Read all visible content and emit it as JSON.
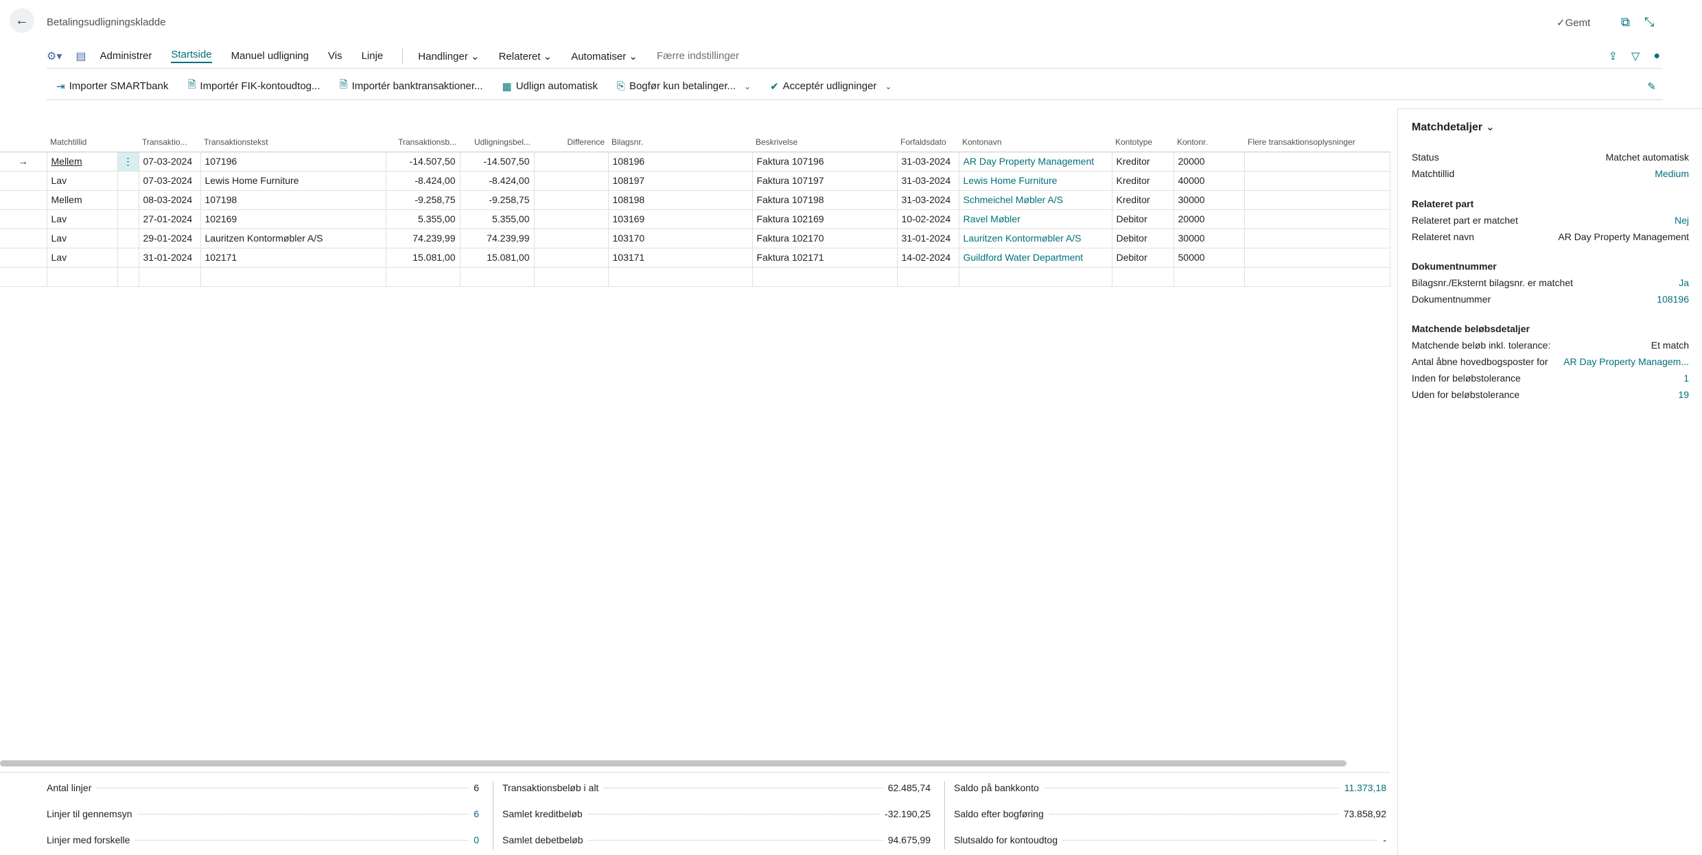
{
  "header": {
    "title": "Betalingsudligningskladde",
    "saved": "Gemt",
    "back_icon": "arrow-left-icon"
  },
  "menu": {
    "items": [
      "Administrer",
      "Startside",
      "Manuel udligning",
      "Vis",
      "Linje"
    ],
    "dropdowns": [
      "Handlinger",
      "Relateret",
      "Automatiser"
    ],
    "fewer": "Færre indstillinger"
  },
  "actions": {
    "import_smartbank": "Importer SMARTbank",
    "import_fik": "Importér FIK-kontoudtog...",
    "import_bank": "Importér banktransaktioner...",
    "auto_apply": "Udlign automatisk",
    "post_payments": "Bogfør kun betalinger...",
    "accept": "Acceptér udligninger"
  },
  "grid": {
    "columns": [
      "Matchtillid",
      "Transaktio...",
      "Transaktionstekst",
      "Transaktionsb...",
      "Udligningsbel...",
      "Difference",
      "Bilagsnr.",
      "Beskrivelse",
      "Forfaldsdato",
      "Kontonavn",
      "Kontotype",
      "Kontonr.",
      "Flere transaktionsoplysninger"
    ],
    "rows": [
      {
        "conf": "Mellem",
        "date": "07-03-2024",
        "text": "107196",
        "amount": "-14.507,50",
        "applied": "-14.507,50",
        "diff": "",
        "doc": "108196",
        "desc": "Faktura 107196",
        "due": "31-03-2024",
        "account": "AR Day Property Management",
        "type": "Kreditor",
        "no": "20000",
        "more": ""
      },
      {
        "conf": "Lav",
        "date": "07-03-2024",
        "text": "Lewis Home Furniture",
        "amount": "-8.424,00",
        "applied": "-8.424,00",
        "diff": "",
        "doc": "108197",
        "desc": "Faktura 107197",
        "due": "31-03-2024",
        "account": "Lewis Home Furniture",
        "type": "Kreditor",
        "no": "40000",
        "more": ""
      },
      {
        "conf": "Mellem",
        "date": "08-03-2024",
        "text": "107198",
        "amount": "-9.258,75",
        "applied": "-9.258,75",
        "diff": "",
        "doc": "108198",
        "desc": "Faktura 107198",
        "due": "31-03-2024",
        "account": "Schmeichel Møbler A/S",
        "type": "Kreditor",
        "no": "30000",
        "more": ""
      },
      {
        "conf": "Lav",
        "date": "27-01-2024",
        "text": "102169",
        "amount": "5.355,00",
        "applied": "5.355,00",
        "diff": "",
        "doc": "103169",
        "desc": "Faktura 102169",
        "due": "10-02-2024",
        "account": "Ravel Møbler",
        "type": "Debitor",
        "no": "20000",
        "more": ""
      },
      {
        "conf": "Lav",
        "date": "29-01-2024",
        "text": "Lauritzen Kontormøbler A/S",
        "amount": "74.239,99",
        "applied": "74.239,99",
        "diff": "",
        "doc": "103170",
        "desc": "Faktura 102170",
        "due": "31-01-2024",
        "account": "Lauritzen Kontormøbler A/S",
        "type": "Debitor",
        "no": "30000",
        "more": ""
      },
      {
        "conf": "Lav",
        "date": "31-01-2024",
        "text": "102171",
        "amount": "15.081,00",
        "applied": "15.081,00",
        "diff": "",
        "doc": "103171",
        "desc": "Faktura 102171",
        "due": "14-02-2024",
        "account": "Guildford Water Department",
        "type": "Debitor",
        "no": "50000",
        "more": ""
      }
    ]
  },
  "footer": {
    "col1": [
      {
        "label": "Antal linjer",
        "value": "6"
      },
      {
        "label": "Linjer til gennemsyn",
        "value": "6"
      },
      {
        "label": "Linjer med forskelle",
        "value": "0"
      }
    ],
    "col2": [
      {
        "label": "Transaktionsbeløb i alt",
        "value": "62.485,74"
      },
      {
        "label": "Samlet kreditbeløb",
        "value": "-32.190,25"
      },
      {
        "label": "Samlet debetbeløb",
        "value": "94.675,99"
      }
    ],
    "col3": [
      {
        "label": "Saldo på bankkonto",
        "value": "11.373,18"
      },
      {
        "label": "Saldo efter bogføring",
        "value": "73.858,92"
      },
      {
        "label": "Slutsaldo for kontoudtog",
        "value": "-"
      }
    ]
  },
  "factbox": {
    "title": "Matchdetaljer",
    "status_label": "Status",
    "status_value": "Matchet automatisk",
    "conf_label": "Matchtillid",
    "conf_value": "Medium",
    "sec_related": "Relateret part",
    "rel_matched_label": "Relateret part er matchet",
    "rel_matched_value": "Nej",
    "rel_name_label": "Relateret navn",
    "rel_name_value": "AR Day Property Management",
    "sec_doc": "Dokumentnummer",
    "doc_matched_label": "Bilagsnr./Eksternt bilagsnr. er matchet",
    "doc_matched_value": "Ja",
    "doc_no_label": "Dokumentnummer",
    "doc_no_value": "108196",
    "sec_amount": "Matchende beløbsdetaljer",
    "tol_label": "Matchende beløb inkl. tolerance:",
    "tol_value": "Et match",
    "open_label": "Antal åbne hovedbogsposter for",
    "open_value": "AR Day Property Managem...",
    "within_label": "Inden for beløbstolerance",
    "within_value": "1",
    "outside_label": "Uden for beløbstolerance",
    "outside_value": "19"
  }
}
